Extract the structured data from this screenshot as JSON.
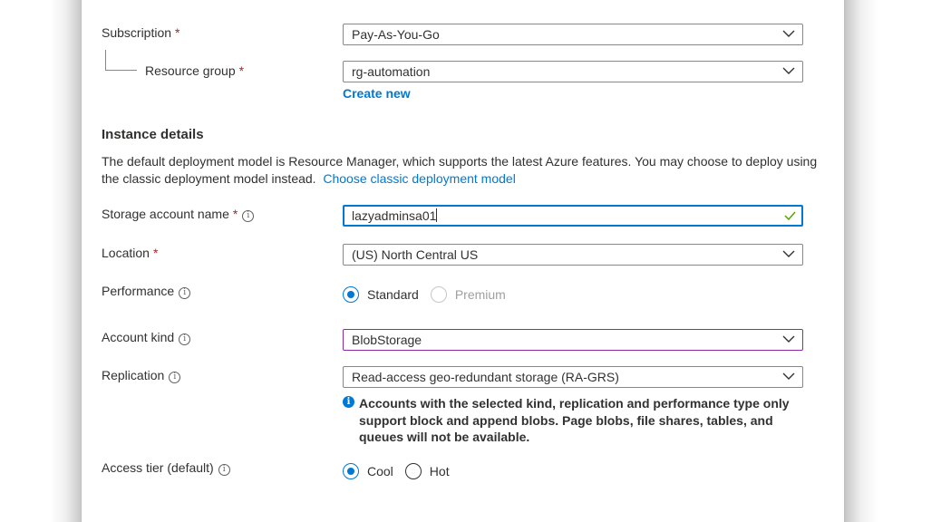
{
  "basics": {
    "subscription": {
      "label": "Subscription",
      "required": "*",
      "value": "Pay-As-You-Go"
    },
    "resource_group": {
      "label": "Resource group",
      "required": "*",
      "value": "rg-automation",
      "create_new": "Create new"
    }
  },
  "instance": {
    "title": "Instance details",
    "description": "The default deployment model is Resource Manager, which supports the latest Azure features. You may choose to deploy using the classic deployment model instead.",
    "classic_link": "Choose classic deployment model",
    "storage_name": {
      "label": "Storage account name",
      "required": "*",
      "value": "lazyadminsa01"
    },
    "location": {
      "label": "Location",
      "required": "*",
      "value": "(US) North Central US"
    },
    "performance": {
      "label": "Performance",
      "options": [
        "Standard",
        "Premium"
      ],
      "selected": "Standard"
    },
    "account_kind": {
      "label": "Account kind",
      "value": "BlobStorage"
    },
    "replication": {
      "label": "Replication",
      "value": "Read-access geo-redundant storage (RA-GRS)",
      "note": "Accounts with the selected kind, replication and performance type only support block and append blobs. Page blobs, file shares, tables, and queues will not be available."
    },
    "access_tier": {
      "label": "Access tier (default)",
      "options": [
        "Cool",
        "Hot"
      ],
      "selected": "Cool"
    }
  },
  "icons": {
    "info": "info-icon",
    "chevron": "chevron-down-icon",
    "check": "check-icon"
  },
  "colors": {
    "accent": "#0078d4",
    "required": "#a4262c",
    "focus_purple": "#8a2da5",
    "valid_check": "#57a300"
  }
}
